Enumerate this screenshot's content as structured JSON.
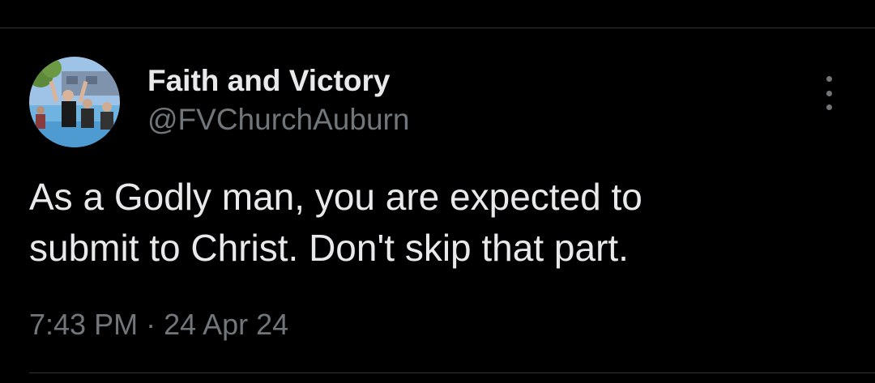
{
  "tweet": {
    "author": {
      "display_name": "Faith and Victory",
      "handle": "@FVChurchAuburn",
      "avatar_icon": "avatar-photo"
    },
    "text": "As a Godly man, you are expected to\nsubmit to Christ.  Don't skip that part.",
    "time": "7:43 PM",
    "separator": "·",
    "date": "24 Apr 24",
    "more_icon": "more-vertical-icon"
  },
  "colors": {
    "background": "#000000",
    "primary_text": "#e7e9ea",
    "secondary_text": "#71767b",
    "divider": "#2f3336"
  }
}
